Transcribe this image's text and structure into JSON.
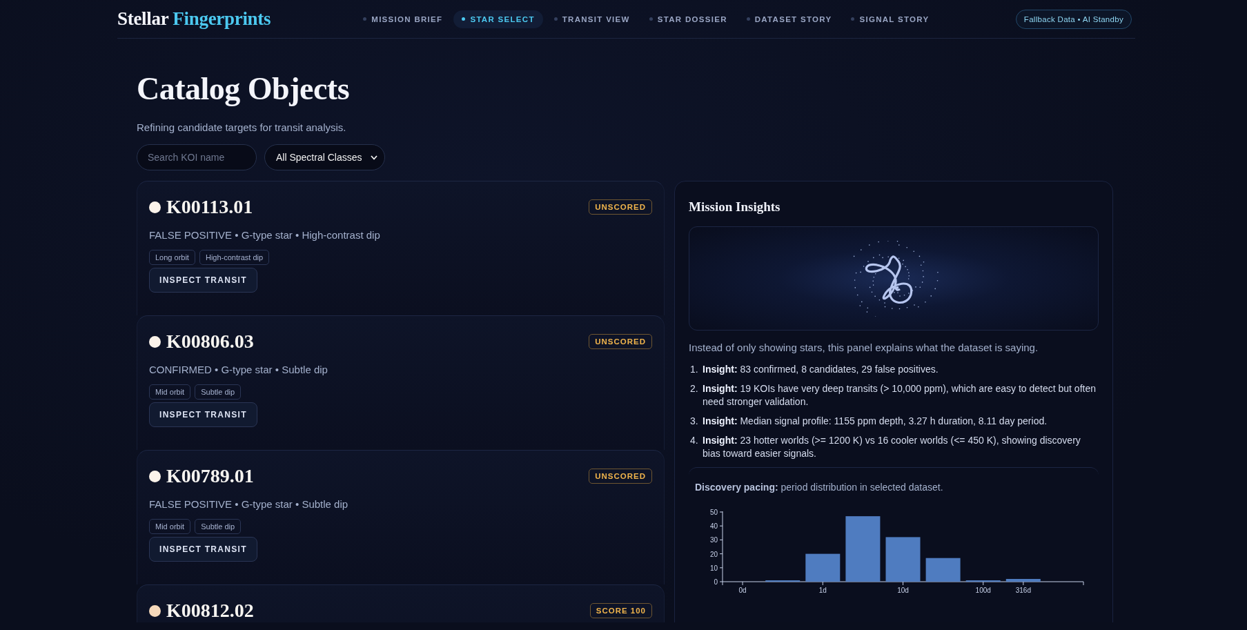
{
  "header": {
    "logo": {
      "text": "Stellar",
      "highlight": "Fingerprints"
    },
    "nav": [
      {
        "label": "MISSION BRIEF",
        "selected": false
      },
      {
        "label": "STAR SELECT",
        "selected": true
      },
      {
        "label": "TRANSIT VIEW",
        "selected": false
      },
      {
        "label": "STAR DOSSIER",
        "selected": false
      },
      {
        "label": "DATASET STORY",
        "selected": false
      },
      {
        "label": "SIGNAL STORY",
        "selected": false
      }
    ],
    "status": "Fallback Data • AI Standby"
  },
  "page": {
    "title": "Catalog Objects",
    "subtitle": "Refining candidate targets for transit analysis.",
    "search": {
      "placeholder": "Search KOI name"
    },
    "filter": {
      "value": "All Spectral Classes"
    }
  },
  "objects": [
    {
      "name": "K00113.01",
      "color": "#fbf3ea",
      "badge": "UNSCORED",
      "meta": "FALSE POSITIVE • G-type star • High-contrast dip",
      "tags": [
        "Long orbit",
        "High-contrast dip"
      ],
      "action": "INSPECT TRANSIT"
    },
    {
      "name": "K00806.03",
      "color": "#fbf3ea",
      "badge": "UNSCORED",
      "meta": "CONFIRMED • G-type star • Subtle dip",
      "tags": [
        "Mid orbit",
        "Subtle dip"
      ],
      "action": "INSPECT TRANSIT"
    },
    {
      "name": "K00789.01",
      "color": "#fbf3ea",
      "badge": "UNSCORED",
      "meta": "FALSE POSITIVE • G-type star • Subtle dip",
      "tags": [
        "Mid orbit",
        "Subtle dip"
      ],
      "action": "INSPECT TRANSIT"
    },
    {
      "name": "K00812.02",
      "color": "#f6d9bb",
      "badge": "SCORE 100"
    }
  ],
  "insights": {
    "title": "Mission Insights",
    "image": {
      "kind": "drawing"
    },
    "intro": "Instead of only showing stars, this panel explains what the dataset is saying.",
    "items": [
      {
        "number": "1.",
        "text": "**Insight:** 83 confirmed, 8 candidates, 29 false positives."
      },
      {
        "number": "2.",
        "text": "**Insight:** 19 KOIs have very deep transits (> 10,000 ppm), which are easy to detect but often need stronger validation."
      },
      {
        "number": "3.",
        "text": "**Insight:** Median signal profile: 1155 ppm depth, 3.27 h duration, 8.11 day period."
      },
      {
        "number": "4.",
        "text": "**Insight:** 23 hotter worlds (>= 1200 K) vs 16 cooler worlds (<= 450 K), showing discovery bias toward easier signals."
      }
    ],
    "pacing": {
      "text": "**Discovery pacing:** period distribution in selected dataset.",
      "chart_data": {
        "type": "bar",
        "categories": [
          "0d",
          null,
          "1d",
          null,
          "10d",
          null,
          "100d",
          "316d",
          null
        ],
        "series": [
          {
            "color": "#4f7cc0",
            "values": [
              0,
              1,
              20,
              47,
              32,
              17,
              1,
              2,
              0
            ]
          }
        ],
        "ylim": [
          0,
          50
        ],
        "yticks": [
          0,
          10,
          20,
          30,
          40,
          50
        ]
      }
    }
  }
}
